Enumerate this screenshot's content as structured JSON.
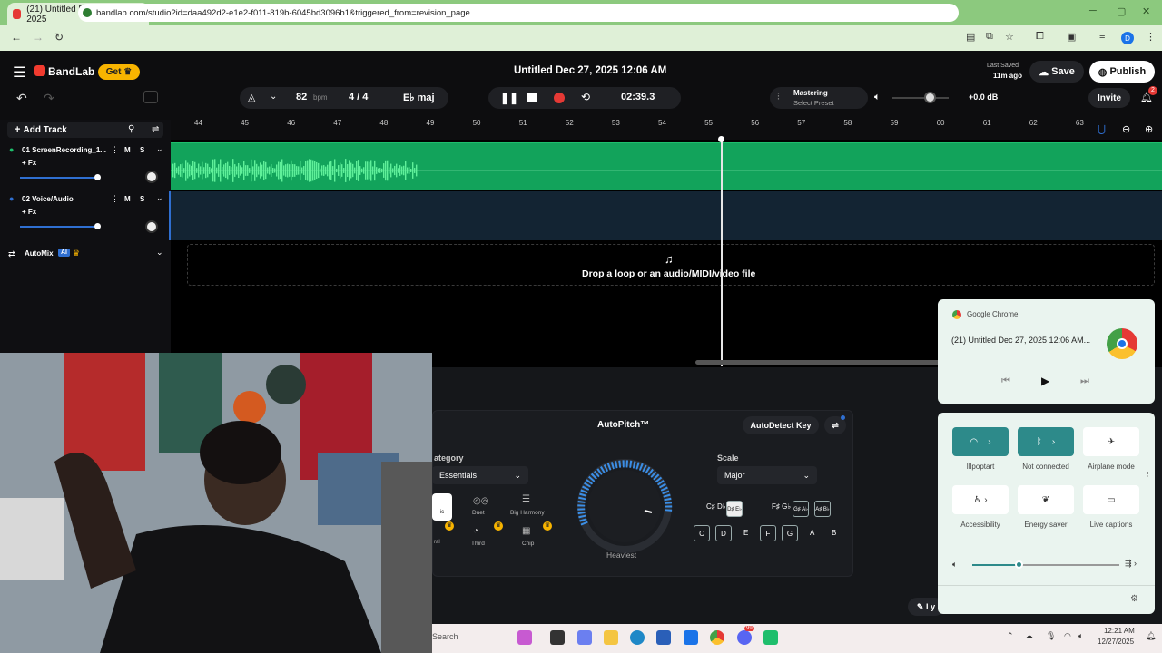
{
  "browser": {
    "tab_title": "(21) Untitled Dec 27, 2025",
    "new_tab": "+",
    "url": "bandlab.com/studio?id=daa492d2-e1e2-f011-819b-6045bd3096b1&triggered_from=revision_page",
    "profile_initial": "D"
  },
  "header": {
    "brand": "BandLab",
    "get_label": "Get",
    "project_title": "Untitled Dec 27, 2025 12:06 AM",
    "last_saved_label": "Last Saved",
    "last_saved_value": "11m ago",
    "save_label": "Save",
    "publish_label": "Publish",
    "invite_label": "Invite",
    "notification_count": "2"
  },
  "transport": {
    "bpm": "82",
    "bpm_unit": "bpm",
    "time_signature": "4 / 4",
    "key": "E♭ maj",
    "time": "02:39.3",
    "mastering_title": "Mastering",
    "mastering_preset": "Select Preset",
    "volume_db": "+0.0 dB"
  },
  "tracks": {
    "add_track": "Add Track",
    "items": [
      {
        "label": "01  ScreenRecording_1...",
        "fx": "+ Fx",
        "m": "M",
        "s": "S"
      },
      {
        "label": "02  Voice/Audio",
        "fx": "+ Fx",
        "m": "M",
        "s": "S"
      }
    ],
    "automix": "AutoMix",
    "ai_badge": "AI"
  },
  "ruler": [
    "44",
    "45",
    "46",
    "47",
    "48",
    "49",
    "50",
    "51",
    "52",
    "53",
    "54",
    "55",
    "56",
    "57",
    "58",
    "59",
    "60",
    "61",
    "62",
    "63"
  ],
  "drop_zone": "Drop a loop or an audio/MIDI/video file",
  "autopitch": {
    "title": "AutoPitch™",
    "autodetect": "AutoDetect Key",
    "category_label": "ategory",
    "category_value": "Essentials",
    "scale_label": "Scale",
    "scale_value": "Major",
    "knob_label": "Heaviest",
    "presets": [
      "Duet",
      "Big Harmony",
      "Third",
      "Chip"
    ],
    "partial_left": [
      "ic",
      "ral"
    ],
    "sharps": [
      "C♯ D♭",
      "D♯ E♭",
      "F♯ G♭",
      "G♯ A♭",
      "A♯ B♭"
    ],
    "naturals": [
      "C",
      "D",
      "E",
      "F",
      "G",
      "A",
      "B"
    ]
  },
  "chrome_media": {
    "app": "Google Chrome",
    "title": "(21) Untitled Dec 27, 2025 12:06 AM..."
  },
  "quick_settings": {
    "wifi_label": "Illpoptart",
    "bluetooth_label": "Not connected",
    "airplane_label": "Airplane mode",
    "accessibility_label": "Accessibility",
    "energy_label": "Energy saver",
    "captions_label": "Live captions",
    "volume_level": 0.32
  },
  "taskbar": {
    "search_placeholder": "Search",
    "time": "12:21 AM",
    "date": "12/27/2025",
    "notif_badge": "99"
  },
  "partial_overlay_text": "Ly"
}
